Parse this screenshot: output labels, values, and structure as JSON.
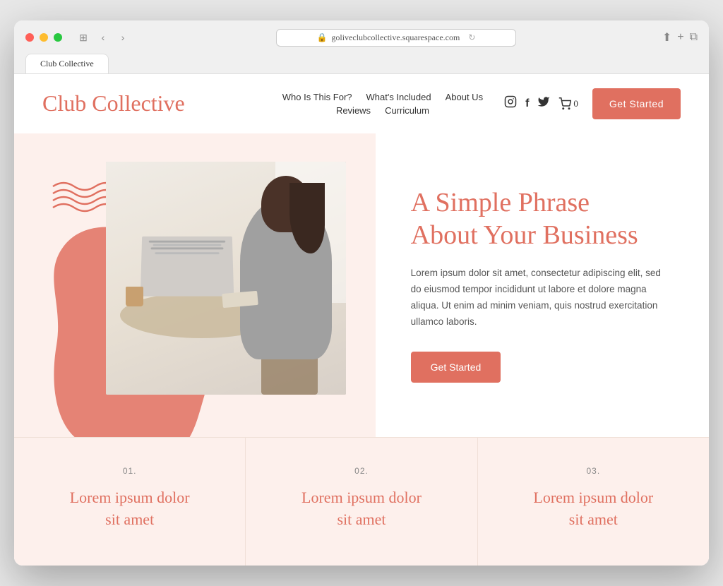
{
  "browser": {
    "url": "goliveclubcollective.squarespace.com",
    "tab_title": "Club Collective"
  },
  "header": {
    "logo": "Club Collective",
    "nav": {
      "row1": [
        {
          "label": "Who Is This For?",
          "id": "who"
        },
        {
          "label": "What's Included",
          "id": "whats-included"
        },
        {
          "label": "About Us",
          "id": "about"
        }
      ],
      "row2": [
        {
          "label": "Reviews",
          "id": "reviews"
        },
        {
          "label": "Curriculum",
          "id": "curriculum"
        }
      ]
    },
    "cart_count": "0",
    "cta_button": "Get Started"
  },
  "hero": {
    "heading_line1": "A Simple Phrase",
    "heading_line2": "About Your Business",
    "body_text": "Lorem ipsum dolor sit amet, consectetur adipiscing elit, sed do eiusmod tempor incididunt ut labore et dolore magna aliqua. Ut enim ad minim veniam, quis nostrud exercitation ullamco laboris.",
    "cta_button": "Get Started"
  },
  "features": [
    {
      "number": "01.",
      "title_line1": "Lorem ipsum dolor",
      "title_line2": "sit amet"
    },
    {
      "number": "02.",
      "title_line1": "Lorem ipsum dolor",
      "title_line2": "sit amet"
    },
    {
      "number": "03.",
      "title_line1": "Lorem ipsum dolor",
      "title_line2": "sit amet"
    }
  ],
  "icons": {
    "instagram": "📷",
    "facebook": "f",
    "twitter": "🐦",
    "cart": "🛒",
    "back": "‹",
    "forward": "›",
    "sidebar": "⊞",
    "refresh": "↻",
    "share": "⬆",
    "new_tab": "+",
    "tabs": "⧉"
  },
  "colors": {
    "brand_coral": "#e07060",
    "bg_light": "#fdf0ec",
    "text_dark": "#333333",
    "text_muted": "#888888"
  }
}
